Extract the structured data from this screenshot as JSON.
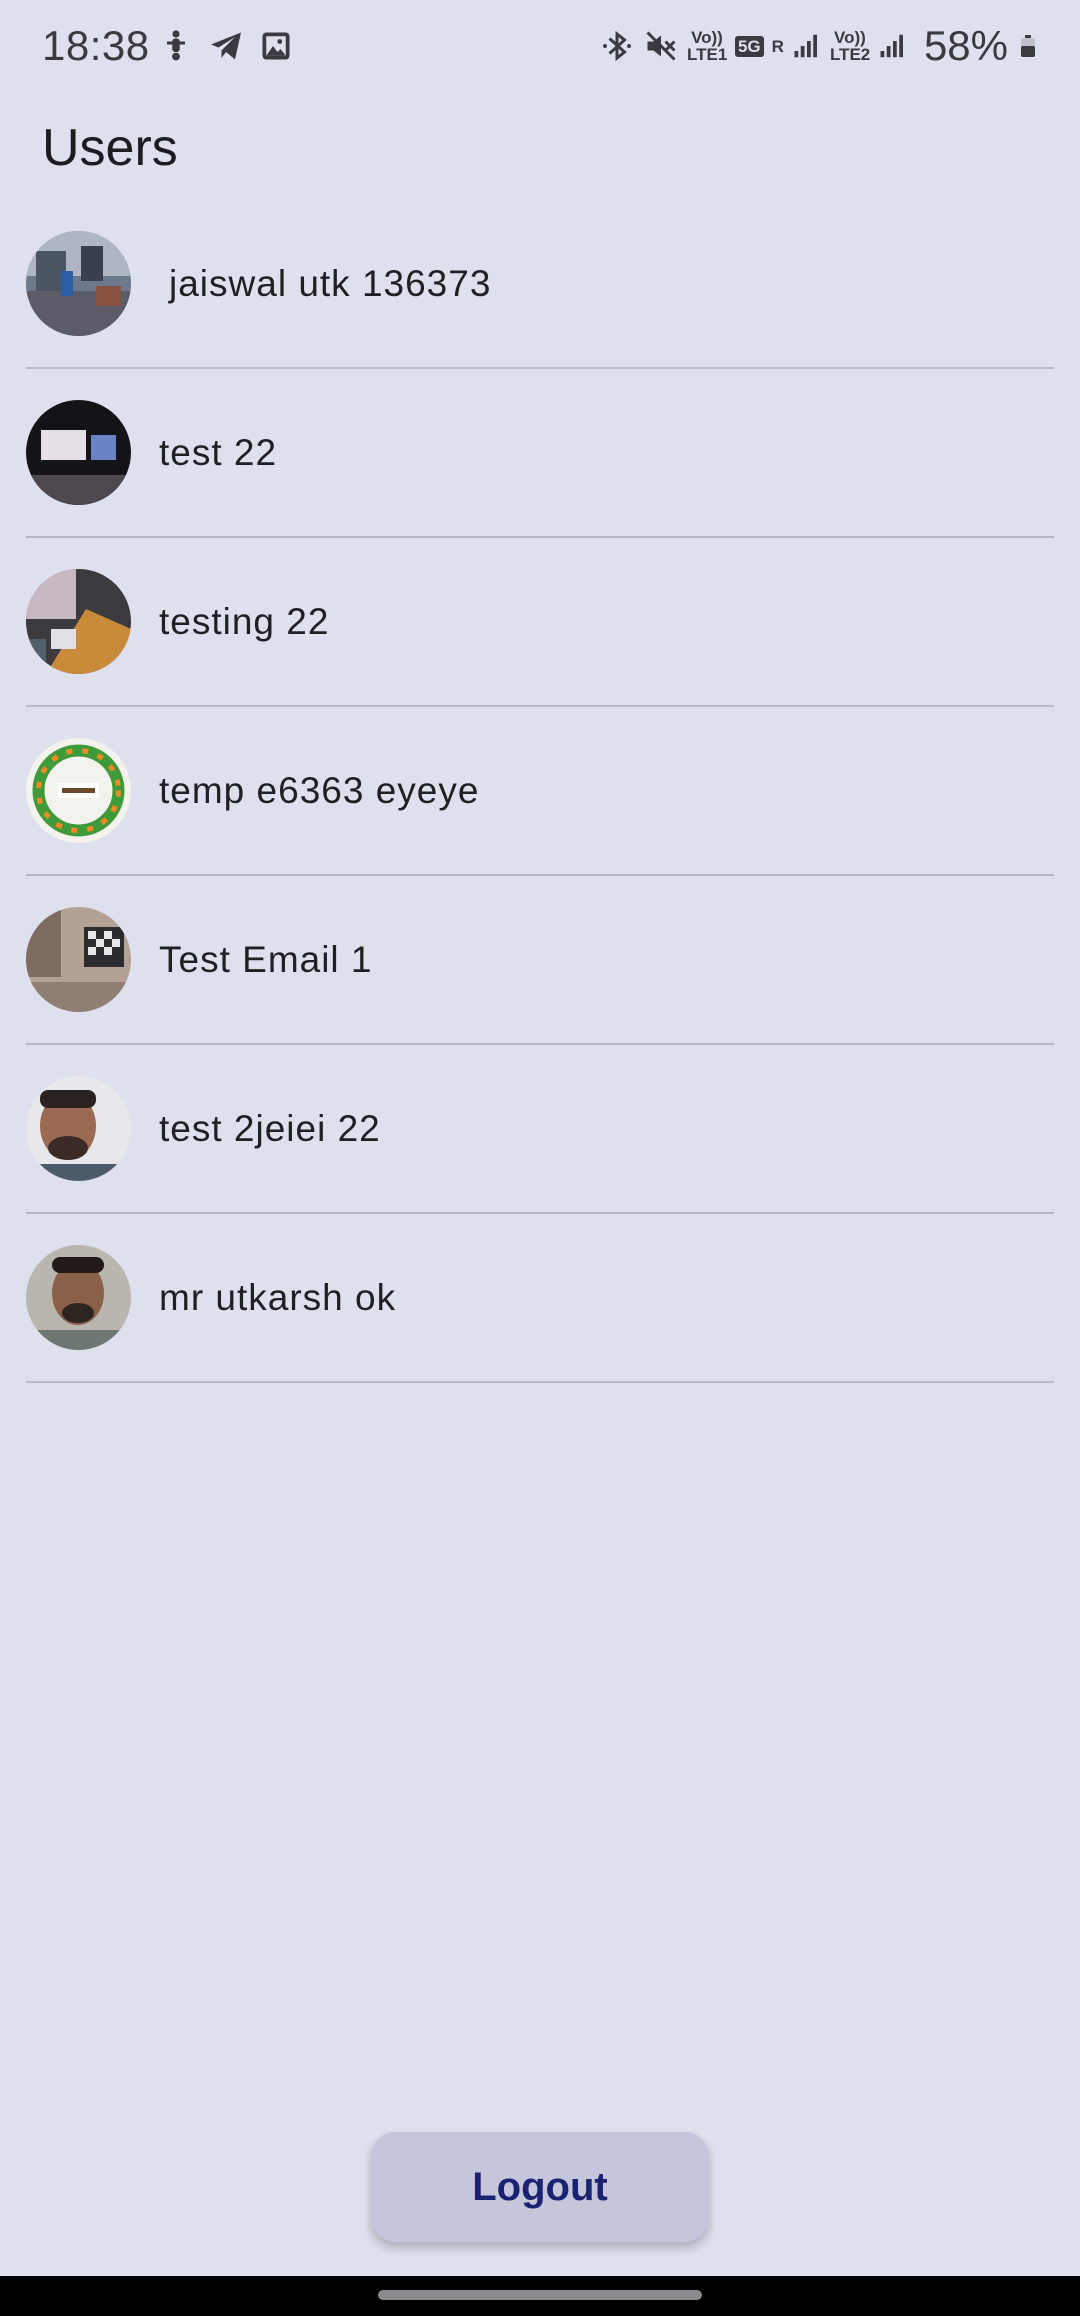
{
  "status_bar": {
    "time": "18:38",
    "battery": "58%",
    "network": {
      "sim1": "Vo)) LTE1",
      "data": "5G",
      "roaming": "R",
      "sim2": "Vo)) LTE2"
    },
    "icons": [
      "scooter-notification-icon",
      "telegram-icon",
      "gallery-icon",
      "bluetooth-icon",
      "mute-icon",
      "signal-icon",
      "battery-icon"
    ]
  },
  "header": {
    "title": "Users"
  },
  "users": [
    {
      "name": " jaiswal  utk 136373"
    },
    {
      "name": "test 22"
    },
    {
      "name": "testing 22"
    },
    {
      "name": "temp e6363 eyeye"
    },
    {
      "name": "Test Email 1"
    },
    {
      "name": "test 2jeiei 22"
    },
    {
      "name": "mr utkarsh ok"
    }
  ],
  "actions": {
    "logout_label": "Logout"
  },
  "colors": {
    "background": "#dfe0ed",
    "button_bg": "#c5c5db",
    "button_text": "#1a2372",
    "divider": "#b8b9c2"
  }
}
